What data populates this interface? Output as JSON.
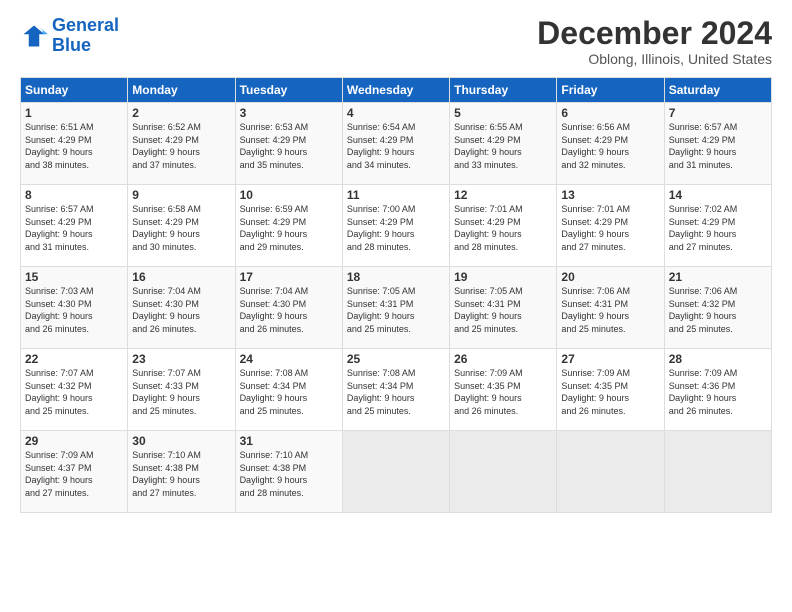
{
  "logo": {
    "line1": "General",
    "line2": "Blue"
  },
  "header": {
    "month": "December 2024",
    "location": "Oblong, Illinois, United States"
  },
  "weekdays": [
    "Sunday",
    "Monday",
    "Tuesday",
    "Wednesday",
    "Thursday",
    "Friday",
    "Saturday"
  ],
  "weeks": [
    [
      {
        "day": "1",
        "info": "Sunrise: 6:51 AM\nSunset: 4:29 PM\nDaylight: 9 hours\nand 38 minutes."
      },
      {
        "day": "2",
        "info": "Sunrise: 6:52 AM\nSunset: 4:29 PM\nDaylight: 9 hours\nand 37 minutes."
      },
      {
        "day": "3",
        "info": "Sunrise: 6:53 AM\nSunset: 4:29 PM\nDaylight: 9 hours\nand 35 minutes."
      },
      {
        "day": "4",
        "info": "Sunrise: 6:54 AM\nSunset: 4:29 PM\nDaylight: 9 hours\nand 34 minutes."
      },
      {
        "day": "5",
        "info": "Sunrise: 6:55 AM\nSunset: 4:29 PM\nDaylight: 9 hours\nand 33 minutes."
      },
      {
        "day": "6",
        "info": "Sunrise: 6:56 AM\nSunset: 4:29 PM\nDaylight: 9 hours\nand 32 minutes."
      },
      {
        "day": "7",
        "info": "Sunrise: 6:57 AM\nSunset: 4:29 PM\nDaylight: 9 hours\nand 31 minutes."
      }
    ],
    [
      {
        "day": "8",
        "info": "Sunrise: 6:57 AM\nSunset: 4:29 PM\nDaylight: 9 hours\nand 31 minutes."
      },
      {
        "day": "9",
        "info": "Sunrise: 6:58 AM\nSunset: 4:29 PM\nDaylight: 9 hours\nand 30 minutes."
      },
      {
        "day": "10",
        "info": "Sunrise: 6:59 AM\nSunset: 4:29 PM\nDaylight: 9 hours\nand 29 minutes."
      },
      {
        "day": "11",
        "info": "Sunrise: 7:00 AM\nSunset: 4:29 PM\nDaylight: 9 hours\nand 28 minutes."
      },
      {
        "day": "12",
        "info": "Sunrise: 7:01 AM\nSunset: 4:29 PM\nDaylight: 9 hours\nand 28 minutes."
      },
      {
        "day": "13",
        "info": "Sunrise: 7:01 AM\nSunset: 4:29 PM\nDaylight: 9 hours\nand 27 minutes."
      },
      {
        "day": "14",
        "info": "Sunrise: 7:02 AM\nSunset: 4:29 PM\nDaylight: 9 hours\nand 27 minutes."
      }
    ],
    [
      {
        "day": "15",
        "info": "Sunrise: 7:03 AM\nSunset: 4:30 PM\nDaylight: 9 hours\nand 26 minutes."
      },
      {
        "day": "16",
        "info": "Sunrise: 7:04 AM\nSunset: 4:30 PM\nDaylight: 9 hours\nand 26 minutes."
      },
      {
        "day": "17",
        "info": "Sunrise: 7:04 AM\nSunset: 4:30 PM\nDaylight: 9 hours\nand 26 minutes."
      },
      {
        "day": "18",
        "info": "Sunrise: 7:05 AM\nSunset: 4:31 PM\nDaylight: 9 hours\nand 25 minutes."
      },
      {
        "day": "19",
        "info": "Sunrise: 7:05 AM\nSunset: 4:31 PM\nDaylight: 9 hours\nand 25 minutes."
      },
      {
        "day": "20",
        "info": "Sunrise: 7:06 AM\nSunset: 4:31 PM\nDaylight: 9 hours\nand 25 minutes."
      },
      {
        "day": "21",
        "info": "Sunrise: 7:06 AM\nSunset: 4:32 PM\nDaylight: 9 hours\nand 25 minutes."
      }
    ],
    [
      {
        "day": "22",
        "info": "Sunrise: 7:07 AM\nSunset: 4:32 PM\nDaylight: 9 hours\nand 25 minutes."
      },
      {
        "day": "23",
        "info": "Sunrise: 7:07 AM\nSunset: 4:33 PM\nDaylight: 9 hours\nand 25 minutes."
      },
      {
        "day": "24",
        "info": "Sunrise: 7:08 AM\nSunset: 4:34 PM\nDaylight: 9 hours\nand 25 minutes."
      },
      {
        "day": "25",
        "info": "Sunrise: 7:08 AM\nSunset: 4:34 PM\nDaylight: 9 hours\nand 25 minutes."
      },
      {
        "day": "26",
        "info": "Sunrise: 7:09 AM\nSunset: 4:35 PM\nDaylight: 9 hours\nand 26 minutes."
      },
      {
        "day": "27",
        "info": "Sunrise: 7:09 AM\nSunset: 4:35 PM\nDaylight: 9 hours\nand 26 minutes."
      },
      {
        "day": "28",
        "info": "Sunrise: 7:09 AM\nSunset: 4:36 PM\nDaylight: 9 hours\nand 26 minutes."
      }
    ],
    [
      {
        "day": "29",
        "info": "Sunrise: 7:09 AM\nSunset: 4:37 PM\nDaylight: 9 hours\nand 27 minutes."
      },
      {
        "day": "30",
        "info": "Sunrise: 7:10 AM\nSunset: 4:38 PM\nDaylight: 9 hours\nand 27 minutes."
      },
      {
        "day": "31",
        "info": "Sunrise: 7:10 AM\nSunset: 4:38 PM\nDaylight: 9 hours\nand 28 minutes."
      },
      {
        "day": "",
        "info": ""
      },
      {
        "day": "",
        "info": ""
      },
      {
        "day": "",
        "info": ""
      },
      {
        "day": "",
        "info": ""
      }
    ]
  ]
}
